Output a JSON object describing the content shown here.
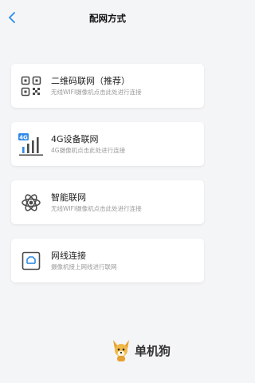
{
  "header": {
    "title": "配网方式"
  },
  "options": [
    {
      "title": "二维码联网（推荐）",
      "subtitle": "无线WIFI摄像机点击此处进行连接",
      "icon": "qr-code-icon"
    },
    {
      "title": "4G设备联网",
      "subtitle": "4G摄像机点击此处进行连接",
      "icon": "4g-signal-icon",
      "icon_badge": "4G"
    },
    {
      "title": "智能联网",
      "subtitle": "无线WIFI摄像机点击此处进行连接",
      "icon": "atom-icon"
    },
    {
      "title": "网线连接",
      "subtitle": "摄像机接上网线进行联网",
      "icon": "ethernet-icon"
    }
  ],
  "watermark": {
    "text": "单机狗",
    "icon": "dog-mascot-icon"
  },
  "colors": {
    "accent": "#2f8ae8",
    "icon_dark": "#4a4a4a",
    "background": "#f4f5f7"
  }
}
